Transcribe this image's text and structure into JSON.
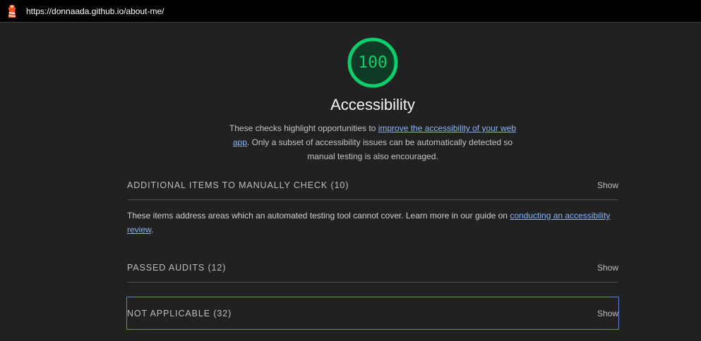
{
  "browser": {
    "url": "https://donnaada.github.io/about-me/",
    "logo_icon": "lighthouse-icon"
  },
  "score": {
    "value": "100",
    "fraction": 1.0,
    "color": "#0cce6b"
  },
  "category": {
    "title": "Accessibility",
    "desc_before": "These checks highlight opportunities to ",
    "desc_link": "improve the accessibility of your web app",
    "desc_after": ". Only a subset of accessibility issues can be automatically detected so manual testing is also encouraged."
  },
  "groups": {
    "manual": {
      "title": "ADDITIONAL ITEMS TO MANUALLY CHECK (10)",
      "show": "Show",
      "desc_before": "These items address areas which an automated testing tool cannot cover. Learn more in our guide on ",
      "desc_link": "conducting an accessibility review",
      "desc_after": "."
    },
    "passed": {
      "title": "PASSED AUDITS (12)",
      "show": "Show"
    },
    "not_applicable": {
      "title": "NOT APPLICABLE (32)",
      "show": "Show"
    }
  },
  "colors": {
    "background": "#212121",
    "link": "#8ab4f8",
    "focus_outline": "#5b7fdd"
  }
}
